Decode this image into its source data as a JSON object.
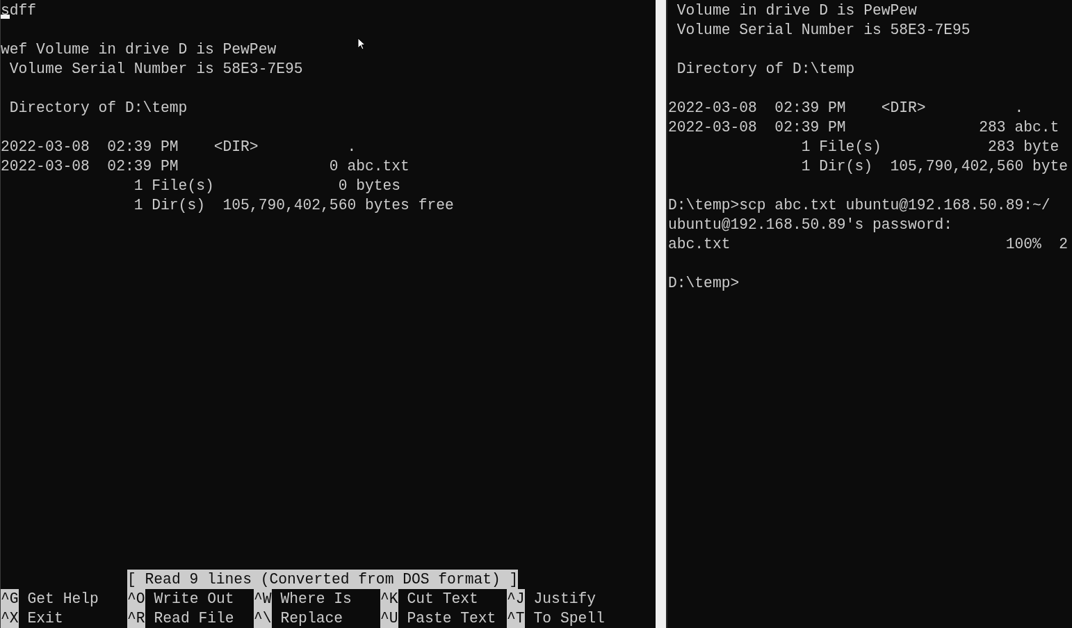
{
  "editor_pane": {
    "blocks": [
      [
        "sdff"
      ],
      [
        "wef Volume in drive D is PewPew",
        " Volume Serial Number is 58E3-7E95"
      ],
      [
        " Directory of D:\\temp"
      ],
      [
        "2022-03-08  02:39 PM    <DIR>          .",
        "2022-03-08  02:39 PM                 0 abc.txt",
        "               1 File(s)              0 bytes",
        "               1 Dir(s)  105,790,402,560 bytes free"
      ]
    ],
    "status": "[ Read 9 lines (Converted from DOS format) ]",
    "shortcut_rows": [
      [
        {
          "key": "^G",
          "label": "Get Help"
        },
        {
          "key": "^O",
          "label": "Write Out"
        },
        {
          "key": "^W",
          "label": "Where Is"
        },
        {
          "key": "^K",
          "label": "Cut Text"
        },
        {
          "key": "^J",
          "label": "Justify"
        }
      ],
      [
        {
          "key": "^X",
          "label": "Exit"
        },
        {
          "key": "^R",
          "label": "Read File"
        },
        {
          "key": "^\\",
          "label": "Replace"
        },
        {
          "key": "^U",
          "label": "Paste Text"
        },
        {
          "key": "^T",
          "label": "To Spell"
        }
      ]
    ]
  },
  "console_pane": {
    "blocks": [
      [
        " Volume in drive D is PewPew",
        " Volume Serial Number is 58E3-7E95"
      ],
      [
        " Directory of D:\\temp"
      ],
      [
        "2022-03-08  02:39 PM    <DIR>          .",
        "2022-03-08  02:39 PM               283 abc.t",
        "               1 File(s)            283 byte",
        "               1 Dir(s)  105,790,402,560 byte"
      ],
      [
        "D:\\temp>scp abc.txt ubuntu@192.168.50.89:~/",
        "ubuntu@192.168.50.89's password:",
        "abc.txt                               100%  2"
      ],
      [
        "D:\\temp>"
      ]
    ]
  }
}
